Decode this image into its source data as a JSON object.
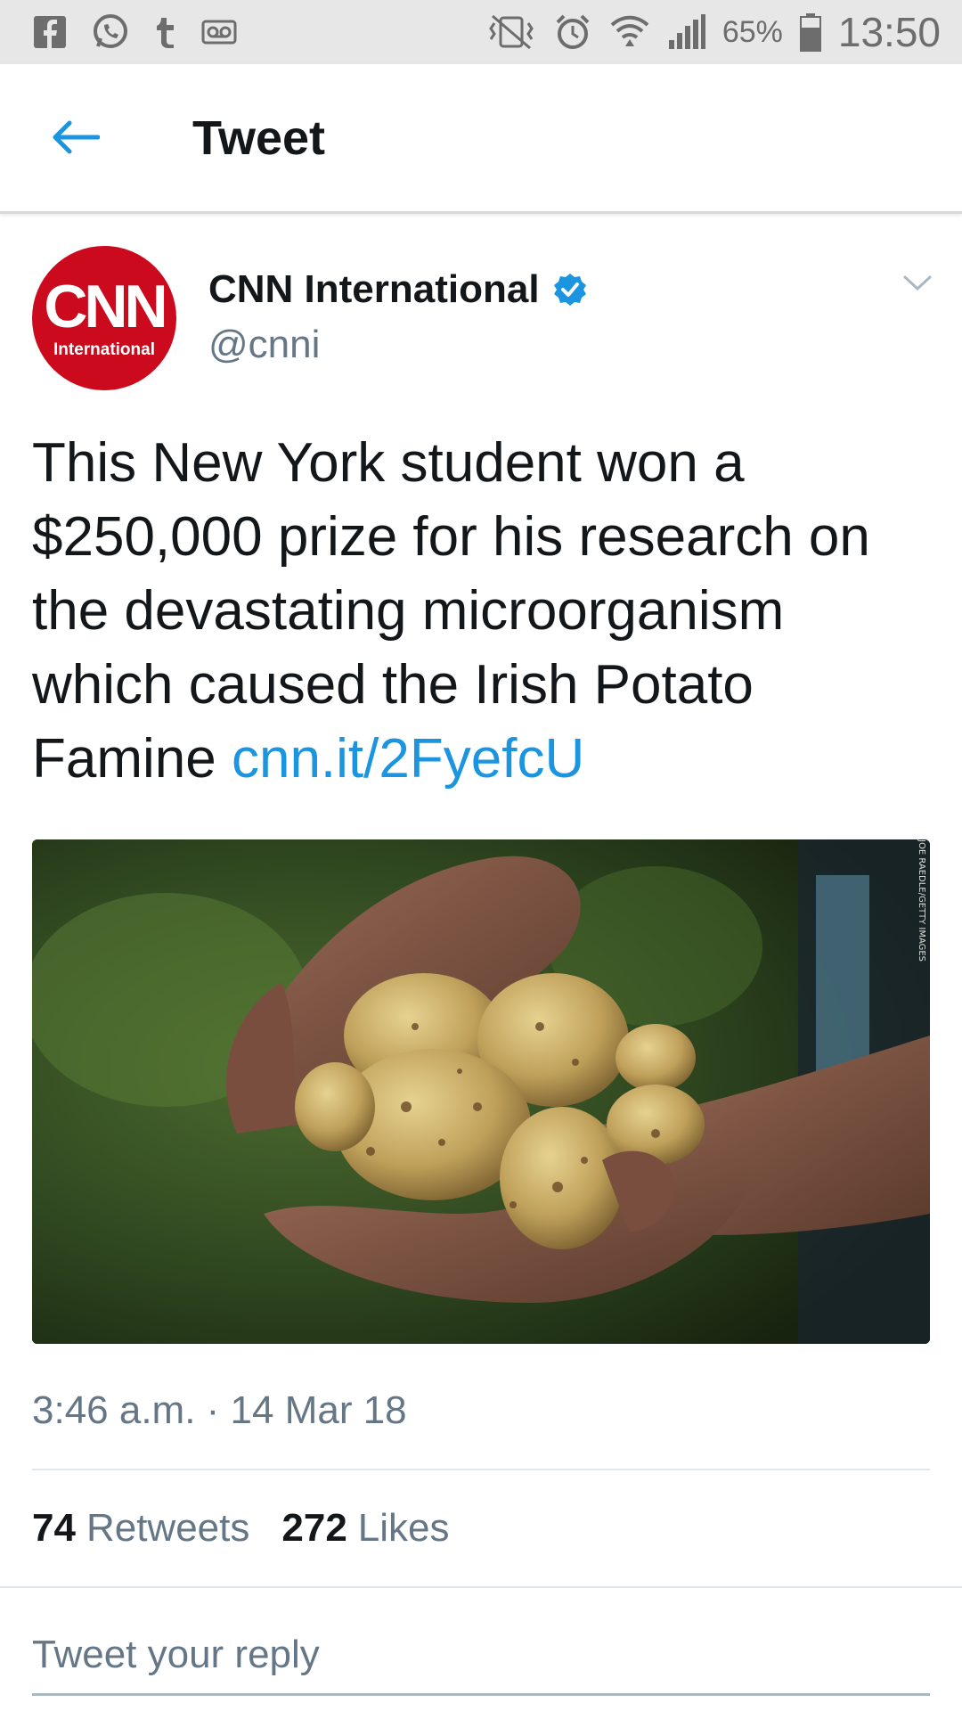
{
  "status_bar": {
    "left_icons": [
      "facebook-icon",
      "whatsapp-icon",
      "tumblr-icon",
      "voicemail-icon"
    ],
    "right_icons": [
      "vibrate-icon",
      "alarm-icon",
      "wifi-icon",
      "signal-icon",
      "battery-icon"
    ],
    "battery_percent": "65%",
    "time": "13:50"
  },
  "app_bar": {
    "back_icon": "arrow-left-icon",
    "title": "Tweet"
  },
  "tweet": {
    "avatar": {
      "logo_text": "CNN",
      "sub_text": "International"
    },
    "author_name": "CNN International",
    "verified": true,
    "handle": "@cnni",
    "text": "This New York student won a $250,000 prize for his research on the devastating microorganism which caused the Irish Potato Famine ",
    "link": "cnn.it/2FyefcU",
    "media": {
      "description_icon": "potatoes-in-hands-photo",
      "credit": "JOE RAEDLE/GETTY IMAGES"
    },
    "timestamp": "3:46 a.m. · 14 Mar 18",
    "stats": {
      "retweets_count": "74",
      "retweets_label": "Retweets",
      "likes_count": "272",
      "likes_label": "Likes"
    },
    "reply_placeholder": "Tweet your reply"
  },
  "colors": {
    "accent": "#1b95e0",
    "text_primary": "#14171a",
    "text_secondary": "#657786",
    "cnn_red": "#cc0a1e",
    "status_bar_bg": "#e7e7e7"
  }
}
